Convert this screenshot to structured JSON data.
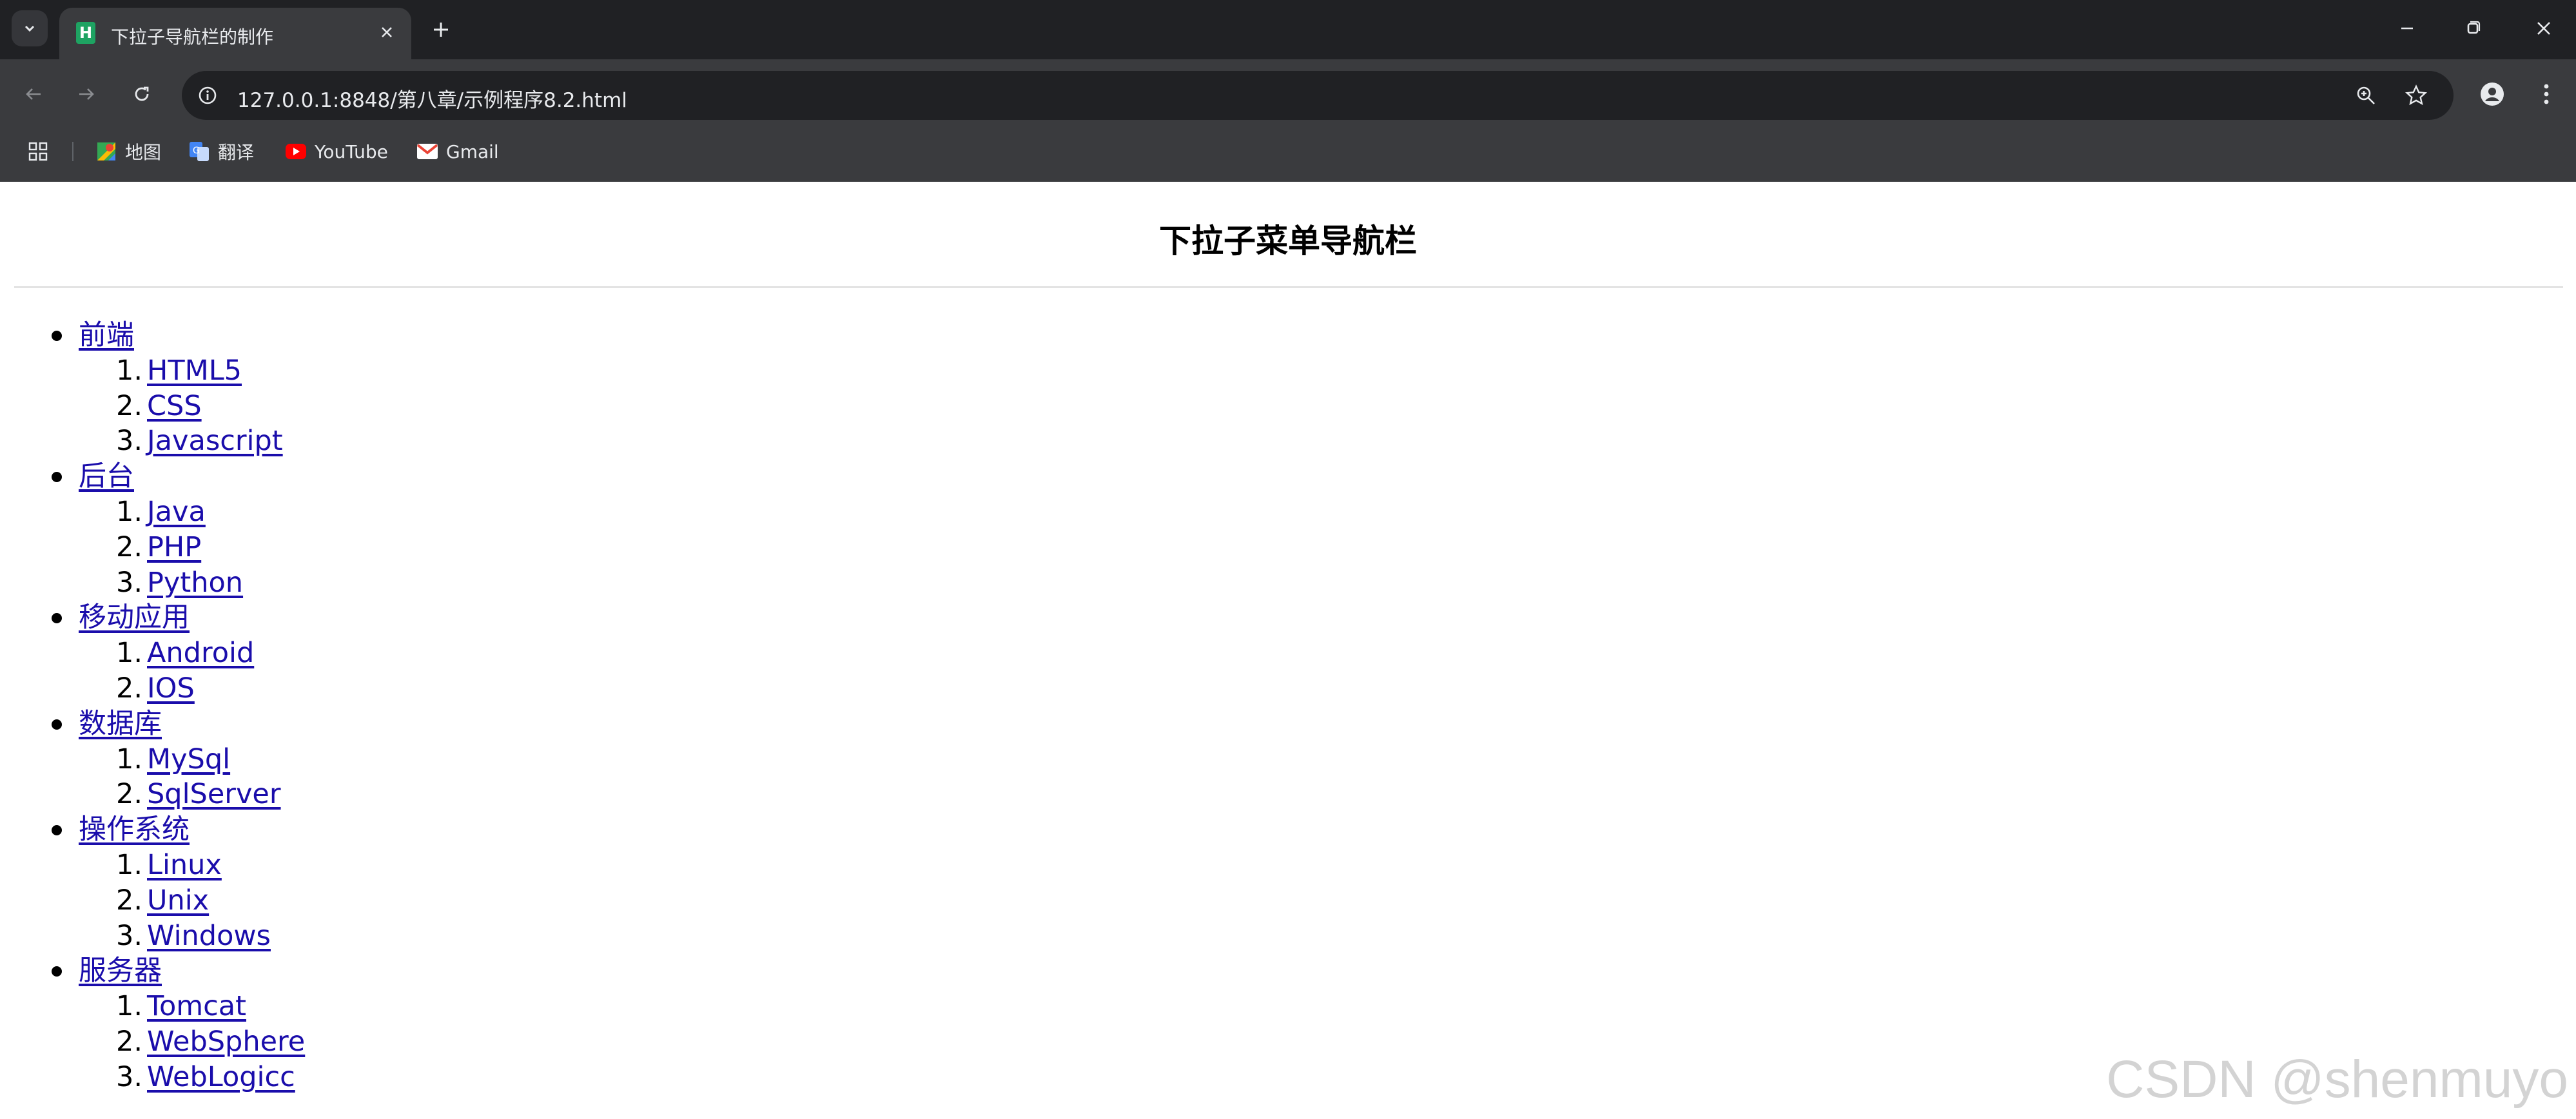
{
  "browser": {
    "tab": {
      "favicon_letter": "H",
      "title": "下拉子导航栏的制作"
    },
    "url": "127.0.0.1:8848/第八章/示例程序8.2.html",
    "bookmarks": [
      {
        "label": "地图",
        "icon": "maps-icon"
      },
      {
        "label": "翻译",
        "icon": "translate-icon"
      },
      {
        "label": "YouTube",
        "icon": "youtube-icon"
      },
      {
        "label": "Gmail",
        "icon": "gmail-icon"
      }
    ],
    "colors": {
      "tab_strip": "#202124",
      "toolbar": "#3a3b3e",
      "link": "#1a0dab"
    }
  },
  "page": {
    "title": "下拉子菜单导航栏",
    "menu": [
      {
        "label": "前端",
        "items": [
          "HTML5",
          "CSS",
          "Javascript"
        ]
      },
      {
        "label": "后台",
        "items": [
          "Java",
          "PHP",
          "Python"
        ]
      },
      {
        "label": "移动应用",
        "items": [
          "Android",
          "IOS"
        ]
      },
      {
        "label": "数据库",
        "items": [
          "MySql",
          "SqlServer"
        ]
      },
      {
        "label": "操作系统",
        "items": [
          "Linux",
          "Unix",
          "Windows"
        ]
      },
      {
        "label": "服务器",
        "items": [
          "Tomcat",
          "WebSphere",
          "WebLogicc"
        ]
      }
    ]
  },
  "watermark": "CSDN @shenmuyo"
}
